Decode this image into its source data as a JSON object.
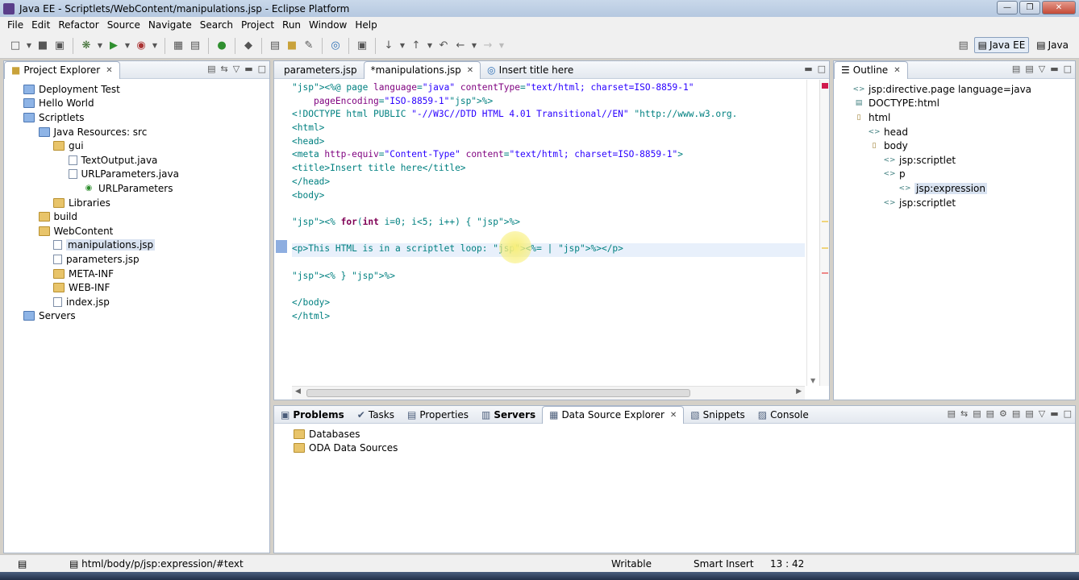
{
  "window": {
    "title": "Java EE - Scriptlets/WebContent/manipulations.jsp - Eclipse Platform"
  },
  "menu": [
    "File",
    "Edit",
    "Refactor",
    "Source",
    "Navigate",
    "Search",
    "Project",
    "Run",
    "Window",
    "Help"
  ],
  "perspectives": {
    "active": "Java EE",
    "other": "Java"
  },
  "project_explorer": {
    "tab": "Project Explorer",
    "items": [
      {
        "label": "Deployment Test",
        "depth": 0,
        "icon": "project-icon"
      },
      {
        "label": "Hello World",
        "depth": 0,
        "icon": "project-icon"
      },
      {
        "label": "Scriptlets",
        "depth": 0,
        "icon": "project-icon"
      },
      {
        "label": "Java Resources: src",
        "depth": 1,
        "icon": "java-resources-icon"
      },
      {
        "label": "gui",
        "depth": 2,
        "icon": "package-icon"
      },
      {
        "label": "TextOutput.java",
        "depth": 3,
        "icon": "java-file-icon"
      },
      {
        "label": "URLParameters.java",
        "depth": 3,
        "icon": "java-file-icon"
      },
      {
        "label": "URLParameters",
        "depth": 4,
        "icon": "class-icon"
      },
      {
        "label": "Libraries",
        "depth": 2,
        "icon": "libraries-icon"
      },
      {
        "label": "build",
        "depth": 1,
        "icon": "folder-icon"
      },
      {
        "label": "WebContent",
        "depth": 1,
        "icon": "folder-icon"
      },
      {
        "label": "manipulations.jsp",
        "depth": 2,
        "icon": "jsp-file-icon",
        "selected": true
      },
      {
        "label": "parameters.jsp",
        "depth": 2,
        "icon": "jsp-file-icon"
      },
      {
        "label": "META-INF",
        "depth": 2,
        "icon": "folder-icon"
      },
      {
        "label": "WEB-INF",
        "depth": 2,
        "icon": "folder-icon"
      },
      {
        "label": "index.jsp",
        "depth": 2,
        "icon": "jsp-file-icon"
      },
      {
        "label": "Servers",
        "depth": 0,
        "icon": "servers-folder-icon"
      }
    ]
  },
  "editor": {
    "tabs": [
      {
        "label": "parameters.jsp",
        "active": false
      },
      {
        "label": "*manipulations.jsp",
        "active": true
      },
      {
        "label": "Insert title here",
        "active": false
      }
    ],
    "lines": [
      "<%@ page language=\"java\" contentType=\"text/html; charset=ISO-8859-1\"",
      "    pageEncoding=\"ISO-8859-1\"%>",
      "<!DOCTYPE html PUBLIC \"-//W3C//DTD HTML 4.01 Transitional//EN\" \"http://www.w3.org.",
      "<html>",
      "<head>",
      "<meta http-equiv=\"Content-Type\" content=\"text/html; charset=ISO-8859-1\">",
      "<title>Insert title here</title>",
      "</head>",
      "<body>",
      "",
      "<% for(int i=0; i<5; i++) { %>",
      "",
      "<p>This HTML is in a scriptlet loop: <%= | %></p>",
      "",
      "<% } %>",
      "",
      "</body>",
      "</html>"
    ]
  },
  "outline": {
    "tab": "Outline",
    "items": [
      {
        "label": "jsp:directive.page language=java",
        "depth": 0,
        "icon": "tag-icon"
      },
      {
        "label": "DOCTYPE:html",
        "depth": 0,
        "icon": "doctype-icon"
      },
      {
        "label": "html",
        "depth": 0,
        "icon": "element-icon"
      },
      {
        "label": "head",
        "depth": 1,
        "icon": "tag-icon"
      },
      {
        "label": "body",
        "depth": 1,
        "icon": "element-icon"
      },
      {
        "label": "jsp:scriptlet",
        "depth": 2,
        "icon": "tag-icon"
      },
      {
        "label": "p",
        "depth": 2,
        "icon": "tag-icon"
      },
      {
        "label": "jsp:expression",
        "depth": 3,
        "icon": "tag-icon",
        "selected": true
      },
      {
        "label": "jsp:scriptlet",
        "depth": 2,
        "icon": "tag-icon"
      }
    ]
  },
  "bottom_panel": {
    "tabs": [
      {
        "label": "Problems",
        "bold": true
      },
      {
        "label": "Tasks"
      },
      {
        "label": "Properties"
      },
      {
        "label": "Servers",
        "bold": true
      },
      {
        "label": "Data Source Explorer",
        "active": true
      },
      {
        "label": "Snippets"
      },
      {
        "label": "Console"
      }
    ],
    "items": [
      "Databases",
      "ODA Data Sources"
    ]
  },
  "status": {
    "path": "html/body/p/jsp:expression/#text",
    "writable": "Writable",
    "insert_mode": "Smart Insert",
    "position": "13 : 42"
  }
}
